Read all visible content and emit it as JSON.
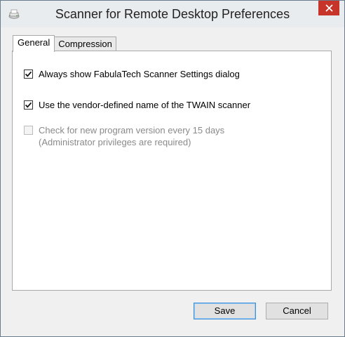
{
  "window": {
    "title": "Scanner for Remote Desktop Preferences",
    "icon": "scanner-app-icon",
    "close_icon": "close-icon"
  },
  "tabs": [
    {
      "label": "General",
      "active": true
    },
    {
      "label": "Compression",
      "active": false
    }
  ],
  "options": [
    {
      "label": "Always show FabulaTech  Scanner Settings dialog",
      "checked": true,
      "enabled": true
    },
    {
      "label": "Use the vendor-defined name of the  TWAIN scanner",
      "checked": true,
      "enabled": true
    },
    {
      "label_line1": "Check for new program version every 15 days",
      "label_line2": "(Administrator privileges are required)",
      "checked": false,
      "enabled": false
    }
  ],
  "buttons": {
    "save": "Save",
    "cancel": "Cancel"
  },
  "colors": {
    "close_button": "#c7352a",
    "default_button_border": "#3c8fd8"
  }
}
